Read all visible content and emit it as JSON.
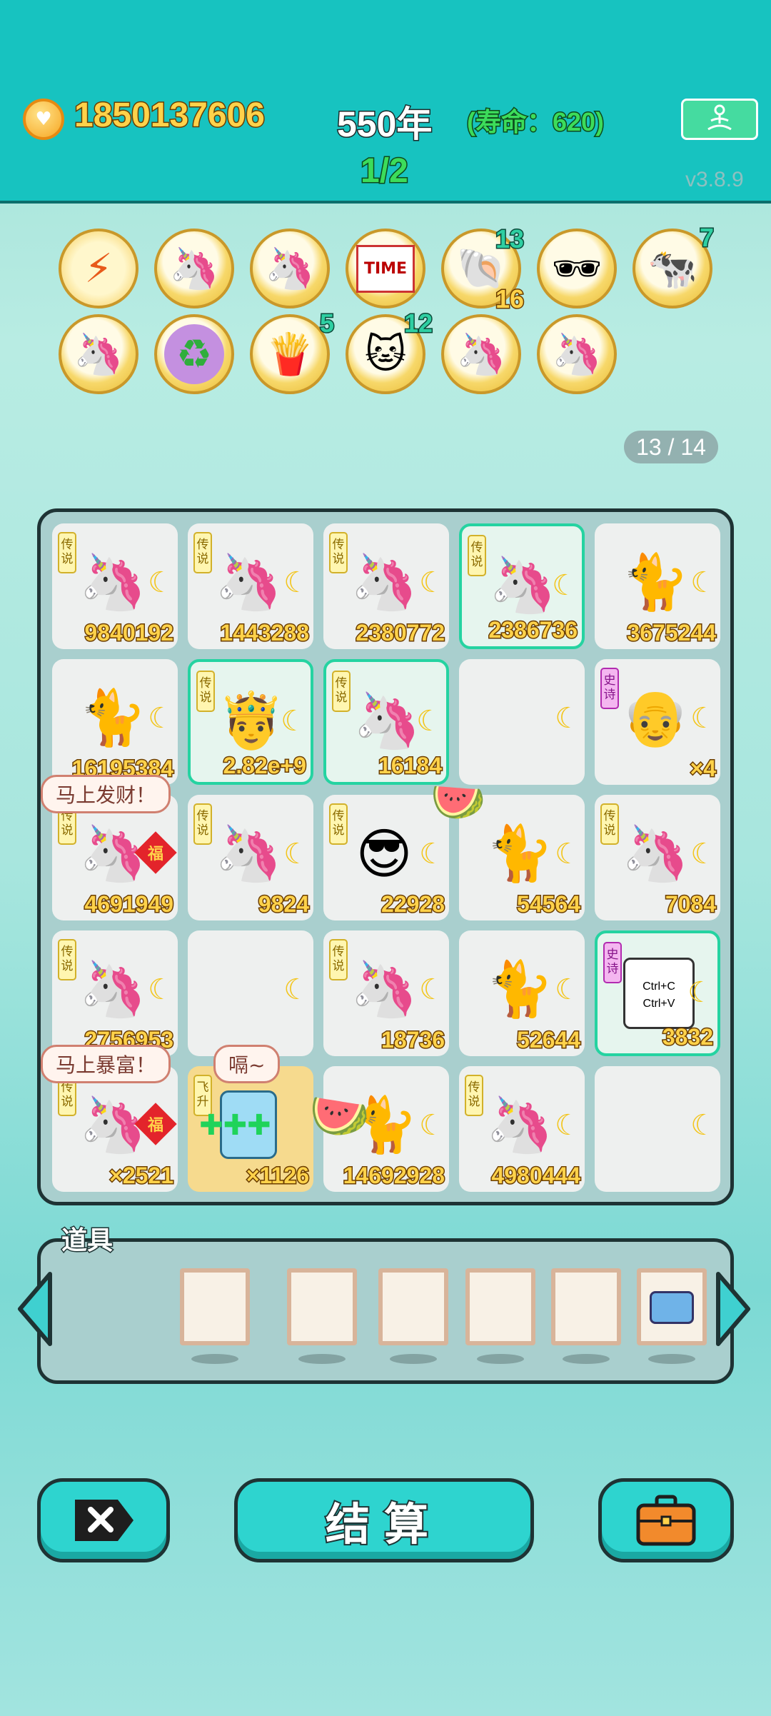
{
  "header": {
    "money": "1850137606",
    "year": "550年",
    "lifespan": "(寿命：620)",
    "round": "1/2",
    "version": "v3.8.9"
  },
  "relics": [
    {
      "icon": "lightning-icon",
      "count": ""
    },
    {
      "icon": "unicorn-icon",
      "count": ""
    },
    {
      "icon": "unicorn-icon",
      "count": ""
    },
    {
      "icon": "time-magazine-icon",
      "count": ""
    },
    {
      "icon": "shell-icon",
      "count": "13",
      "count2": "16"
    },
    {
      "icon": "sunglasses-icon",
      "count": ""
    },
    {
      "icon": "cow-pair-icon",
      "count": "7"
    },
    {
      "icon": "unicorn-icon",
      "count": ""
    },
    {
      "icon": "recycle-icon",
      "count": ""
    },
    {
      "icon": "fries-icon",
      "count": "5"
    },
    {
      "icon": "cat-icon",
      "count": "12"
    },
    {
      "icon": "unicorn-icon",
      "count": ""
    },
    {
      "icon": "unicorn-icon",
      "count": ""
    }
  ],
  "page_indicator": "13 / 14",
  "board": {
    "rows": [
      [
        {
          "type": "unicorn",
          "tag": "传说",
          "value": "9840192"
        },
        {
          "type": "unicorn",
          "tag": "传说",
          "value": "1443288"
        },
        {
          "type": "unicorn",
          "tag": "传说",
          "value": "2380772"
        },
        {
          "type": "unicorn-king",
          "tag": "传说",
          "value": "2386736",
          "hl": true
        },
        {
          "type": "cat",
          "tag": "",
          "value": "3675244"
        }
      ],
      [
        {
          "type": "cat",
          "tag": "",
          "value": "16195384"
        },
        {
          "type": "king-face",
          "tag": "传说",
          "value": "2.82e+9",
          "hl": true
        },
        {
          "type": "unicorn",
          "tag": "传说",
          "value": "16184",
          "hl": true
        },
        {
          "type": "empty",
          "tag": "",
          "value": ""
        },
        {
          "type": "old-man",
          "tag": "史诗",
          "value": "×4"
        }
      ],
      [
        {
          "type": "unicorn-fu",
          "tag": "传说",
          "value": "4691949"
        },
        {
          "type": "unicorn",
          "tag": "传说",
          "value": "9824"
        },
        {
          "type": "psy",
          "tag": "传说",
          "value": "22928"
        },
        {
          "type": "cat",
          "tag": "",
          "value": "54564"
        },
        {
          "type": "unicorn",
          "tag": "传说",
          "value": "7084"
        }
      ],
      [
        {
          "type": "unicorn",
          "tag": "传说",
          "value": "2756953"
        },
        {
          "type": "empty",
          "tag": "",
          "value": ""
        },
        {
          "type": "unicorn",
          "tag": "传说",
          "value": "18736"
        },
        {
          "type": "cat",
          "tag": "",
          "value": "52644"
        },
        {
          "type": "ctrl",
          "tag": "史诗",
          "value": "3832",
          "hl": true
        }
      ],
      [
        {
          "type": "unicorn-fu",
          "tag": "传说",
          "value": "×2521"
        },
        {
          "type": "ice",
          "tag": "飞升",
          "value": "×1126",
          "gold": true
        },
        {
          "type": "cat",
          "tag": "",
          "value": "14692928"
        },
        {
          "type": "unicorn",
          "tag": "传说",
          "value": "4980444"
        },
        {
          "type": "empty",
          "tag": "",
          "value": ""
        }
      ]
    ],
    "bubbles": {
      "b1": "马上发财！",
      "b2": "马上暴富！",
      "b3": "嗝~"
    },
    "ctrl_text": {
      "c": "Ctrl+C",
      "v": "Ctrl+V"
    }
  },
  "props": {
    "title": "道具",
    "slots": 6
  },
  "buttons": {
    "settle": "结算"
  },
  "colors": {
    "header": "#17c3c0",
    "board_bg": "#a9cfce",
    "button": "#2ed4cf",
    "value_text": "#ffd24a"
  }
}
